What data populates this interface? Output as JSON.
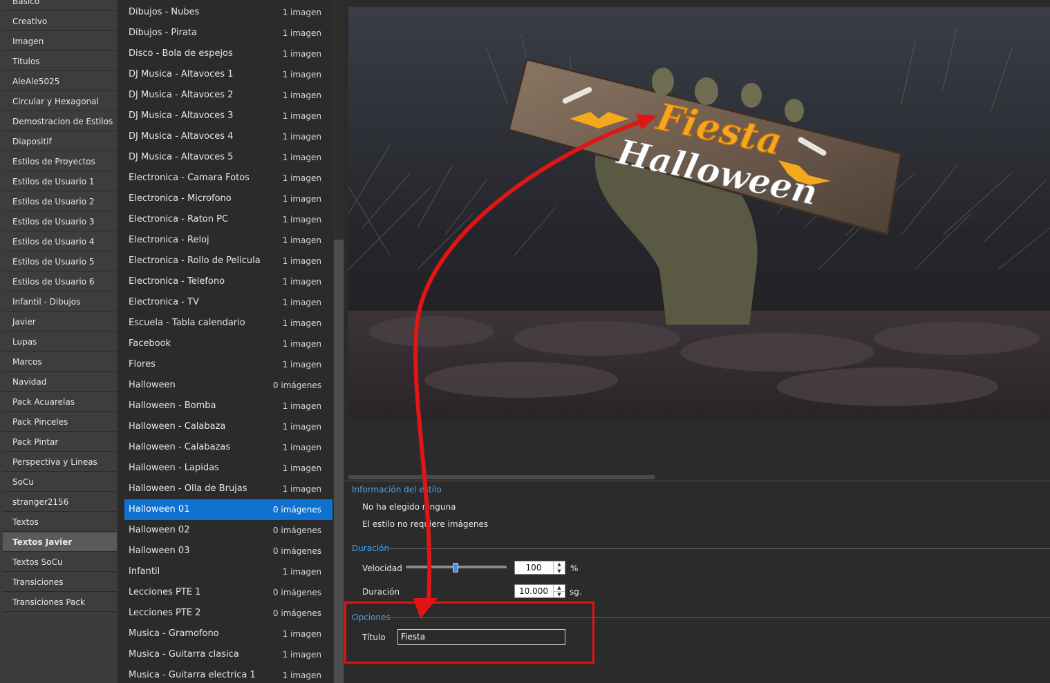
{
  "categories": [
    "Basico",
    "Creativo",
    "Imagen",
    "Titulos",
    "AleAle5025",
    "Circular y Hexagonal",
    "Demostracion de Estilos",
    "Diapositif",
    "Estilos de Proyectos",
    "Estilos de Usuario 1",
    "Estilos de Usuario 2",
    "Estilos de Usuario 3",
    "Estilos de Usuario 4",
    "Estilos de Usuario 5",
    "Estilos de Usuario 6",
    "Infantil - Dibujos",
    "Javier",
    "Lupas",
    "Marcos",
    "Navidad",
    "Pack Acuarelas",
    "Pack Pinceles",
    "Pack Pintar",
    "Perspectiva y Lineas",
    "SoCu",
    "stranger2156",
    "Textos",
    "Textos Javier",
    "Textos SoCu",
    "Transiciones",
    "Transiciones Pack"
  ],
  "selected_category": "Textos Javier",
  "styles": [
    {
      "name": "Dibujos - Nubes",
      "count": "1 imagen"
    },
    {
      "name": "Dibujos - Pirata",
      "count": "1 imagen"
    },
    {
      "name": "Disco - Bola de espejos",
      "count": "1 imagen"
    },
    {
      "name": "DJ Musica - Altavoces 1",
      "count": "1 imagen"
    },
    {
      "name": "DJ Musica - Altavoces 2",
      "count": "1 imagen"
    },
    {
      "name": "DJ Musica - Altavoces 3",
      "count": "1 imagen"
    },
    {
      "name": "DJ Musica - Altavoces 4",
      "count": "1 imagen"
    },
    {
      "name": "DJ Musica - Altavoces 5",
      "count": "1 imagen"
    },
    {
      "name": "Electronica - Camara Fotos",
      "count": "1 imagen"
    },
    {
      "name": "Electronica - Microfono",
      "count": "1 imagen"
    },
    {
      "name": "Electronica - Raton PC",
      "count": "1 imagen"
    },
    {
      "name": "Electronica - Reloj",
      "count": "1 imagen"
    },
    {
      "name": "Electronica - Rollo de Pelicula",
      "count": "1 imagen"
    },
    {
      "name": "Electronica - Telefono",
      "count": "1 imagen"
    },
    {
      "name": "Electronica - TV",
      "count": "1 imagen"
    },
    {
      "name": "Escuela - Tabla calendario",
      "count": "1 imagen"
    },
    {
      "name": "Facebook",
      "count": "1 imagen"
    },
    {
      "name": "Flores",
      "count": "1 imagen"
    },
    {
      "name": "Halloween",
      "count": "0 imágenes"
    },
    {
      "name": "Halloween - Bomba",
      "count": "1 imagen"
    },
    {
      "name": "Halloween - Calabaza",
      "count": "1 imagen"
    },
    {
      "name": "Halloween - Calabazas",
      "count": "1 imagen"
    },
    {
      "name": "Halloween - Lapidas",
      "count": "1 imagen"
    },
    {
      "name": "Halloween - Olla de Brujas",
      "count": "1 imagen"
    },
    {
      "name": "Halloween 01",
      "count": "0 imágenes"
    },
    {
      "name": "Halloween 02",
      "count": "0 imágenes"
    },
    {
      "name": "Halloween 03",
      "count": "0 imágenes"
    },
    {
      "name": "Infantil",
      "count": "1 imagen"
    },
    {
      "name": "Lecciones PTE 1",
      "count": "0 imágenes"
    },
    {
      "name": "Lecciones PTE 2",
      "count": "0 imágenes"
    },
    {
      "name": "Musica - Gramofono",
      "count": "1 imagen"
    },
    {
      "name": "Musica - Guitarra clasica",
      "count": "1 imagen"
    },
    {
      "name": "Musica - Guitarra electrica 1",
      "count": "1 imagen"
    }
  ],
  "selected_style": "Halloween 01",
  "preview": {
    "line1": "Fiesta",
    "line2": "Halloween"
  },
  "info": {
    "section": "Información del estilo",
    "line1": "No ha elegido ninguna",
    "line2": "El estilo no requiere imágenes"
  },
  "duration": {
    "section": "Duración",
    "speed_label": "Velocidad",
    "speed_value": "100",
    "speed_unit": "%",
    "speed_slider_fraction": 0.5,
    "duration_label": "Duración",
    "duration_value": "10.000",
    "duration_unit": "sg."
  },
  "options": {
    "section": "Opciones",
    "title_label": "Título",
    "title_value": "Fiesta"
  },
  "colors": {
    "accent": "#0e71d0",
    "section": "#4aa3e8",
    "highlight": "#e01515"
  }
}
